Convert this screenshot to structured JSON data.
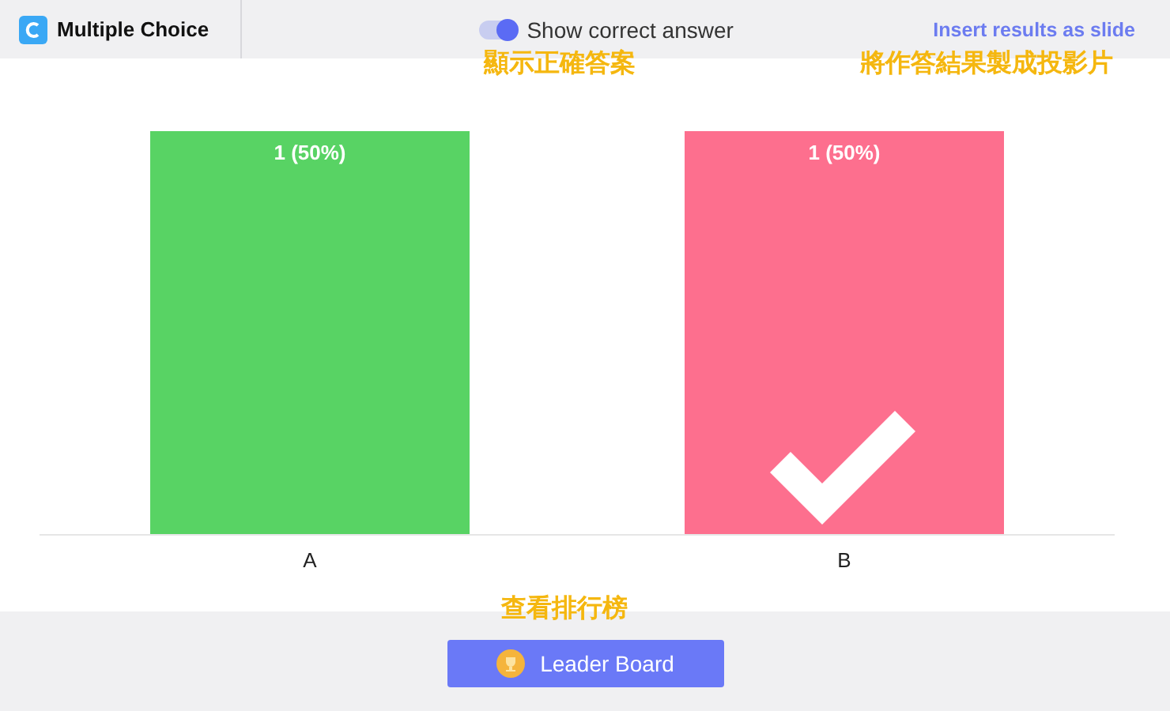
{
  "header": {
    "title": "Multiple Choice",
    "toggle": {
      "label": "Show correct answer",
      "on": true,
      "note": "顯示正確答案"
    },
    "insert_link": "Insert results as slide",
    "insert_note": "將作答結果製成投影片"
  },
  "results": {
    "bars": [
      {
        "color": "#58d364",
        "correct": false
      },
      {
        "color": "#fd6f8e",
        "correct": true
      }
    ],
    "chart_data": {
      "type": "bar",
      "categories": [
        "A",
        "B"
      ],
      "values": [
        1,
        1
      ],
      "value_labels": [
        "1 (50%)",
        "1 (50%)"
      ]
    }
  },
  "leaderboard": {
    "note": "查看排行榜",
    "button": "Leader Board"
  }
}
